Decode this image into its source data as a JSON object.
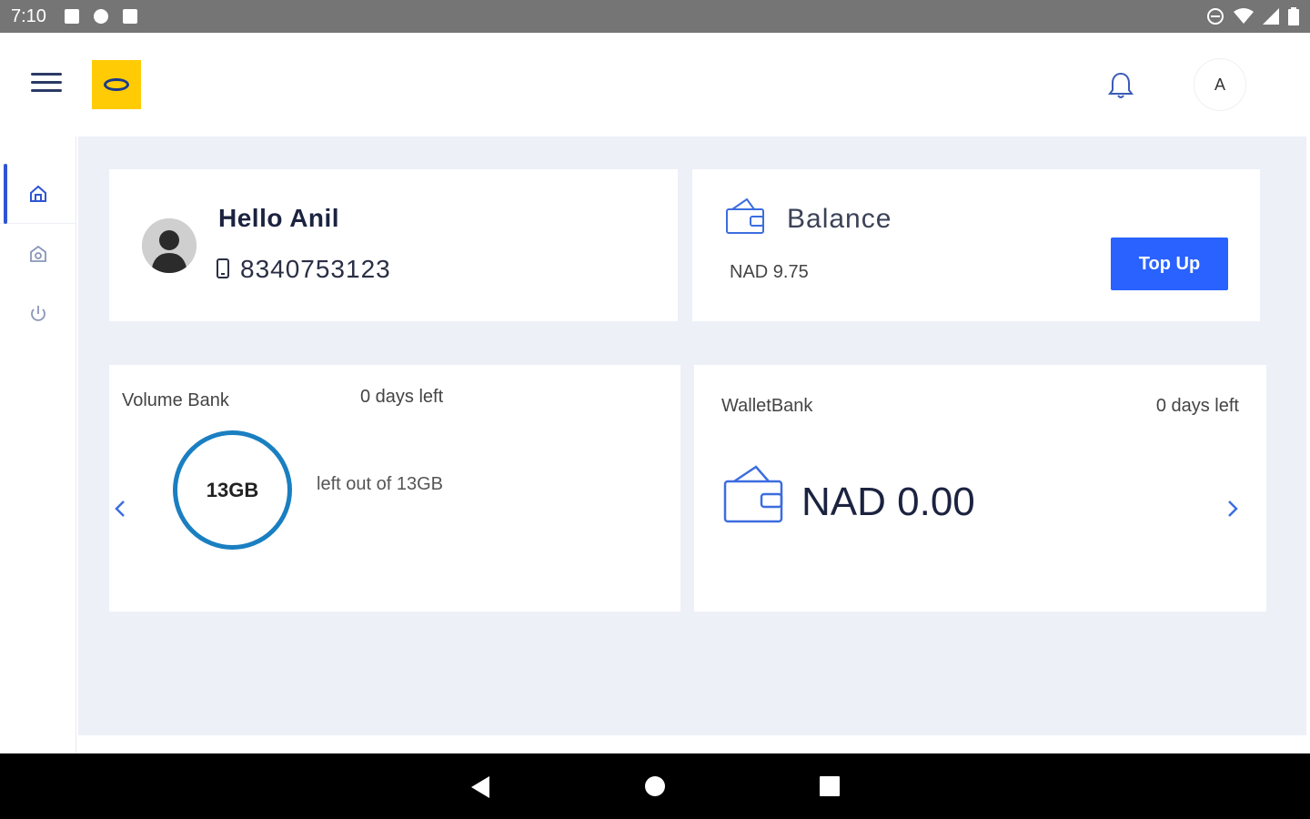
{
  "status_bar": {
    "time": "7:10"
  },
  "header": {
    "avatar_initial": "A"
  },
  "profile": {
    "greeting": "Hello Anil",
    "phone": "8340753123"
  },
  "balance": {
    "title": "Balance",
    "value": "NAD 9.75",
    "topup_label": "Top Up"
  },
  "volume_bank": {
    "title": "Volume Bank",
    "days_left": "0 days left",
    "ring_value": "13GB",
    "description": "left out of 13GB"
  },
  "wallet_bank": {
    "title": "WalletBank",
    "days_left": "0 days left",
    "amount": "NAD 0.00"
  },
  "sidebar": {
    "items": [
      {
        "icon": "home-icon",
        "active": true
      },
      {
        "icon": "gift-icon",
        "active": false
      },
      {
        "icon": "power-icon",
        "active": false
      }
    ]
  },
  "colors": {
    "accent": "#2962ff",
    "brand_yellow": "#ffcb05",
    "ring": "#1a7fc1",
    "background": "#edf0f7"
  }
}
